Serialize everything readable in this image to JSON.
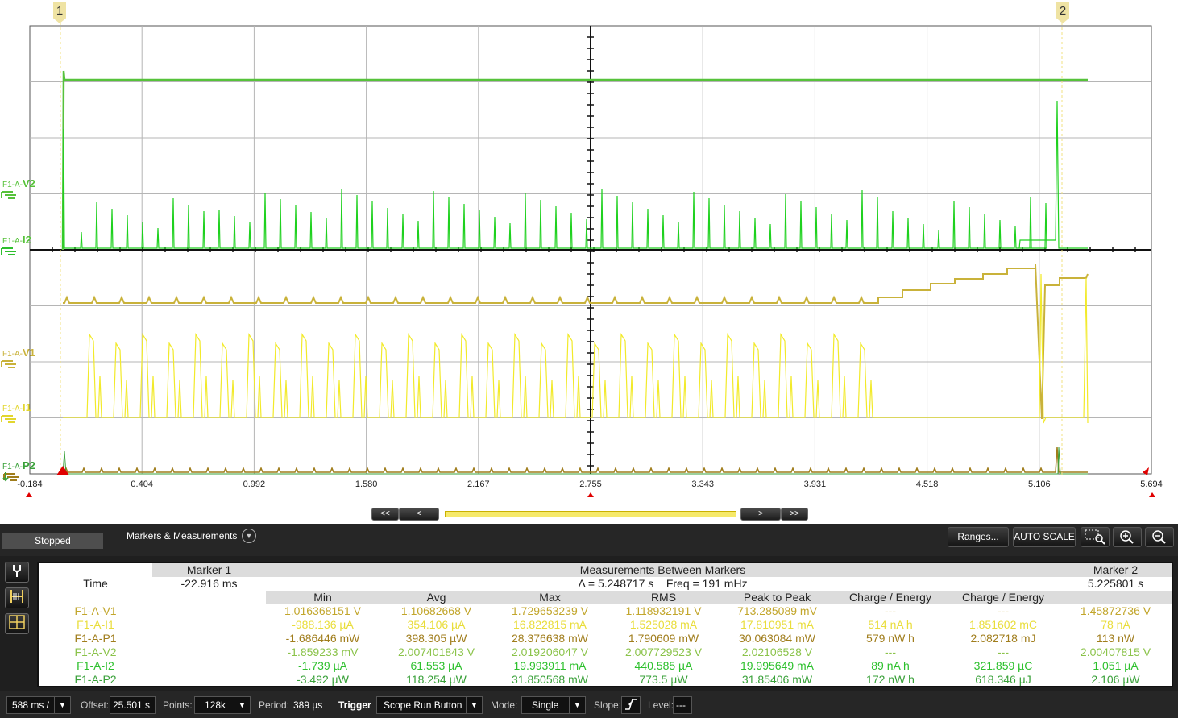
{
  "x_ticks": [
    "-0.184",
    "0.404",
    "0.992",
    "1.580",
    "2.167",
    "2.755",
    "3.343",
    "3.931",
    "4.518",
    "5.106",
    "5.694"
  ],
  "markers": {
    "m1": "1",
    "m2": "2"
  },
  "channels": {
    "V2": {
      "prefix": "F1-A-",
      "name": "V2"
    },
    "I2": {
      "prefix": "F1-A-",
      "name": "I2"
    },
    "V1": {
      "prefix": "F1-A-",
      "name": "V1"
    },
    "I1": {
      "prefix": "F1-A-",
      "name": "I1"
    },
    "P2": {
      "prefix": "F1-A-",
      "name": "P2"
    }
  },
  "nav": {
    "first": "<<",
    "prev": "<",
    "next": ">",
    "last": ">>"
  },
  "status": "Stopped",
  "panel_title": "Markers & Measurements",
  "toolbar": {
    "ranges": "Ranges...",
    "autoscale": "AUTO SCALE"
  },
  "measurements": {
    "marker1_header": "Marker 1",
    "between_header": "Measurements Between Markers",
    "marker2_header": "Marker 2",
    "time_label": "Time",
    "marker1_time": "-22.916 ms",
    "delta": "Δ = 5.248717 s    Freq = 191 mHz",
    "marker2_time": "5.225801 s",
    "columns": [
      "Min",
      "Avg",
      "Max",
      "RMS",
      "Peak to Peak",
      "Charge / Energy",
      "Charge / Energy"
    ],
    "rows": [
      {
        "key": "V1",
        "name": "F1-A-V1",
        "m1": "",
        "cells": [
          "1.016368151 V",
          "1.10682668 V",
          "1.729653239 V",
          "1.118932191 V",
          "713.285089 mV",
          "---",
          "---"
        ],
        "m2": "1.45872736 V"
      },
      {
        "key": "I1",
        "name": "F1-A-I1",
        "m1": "",
        "cells": [
          "-988.136 µA",
          "354.106 µA",
          "16.822815 mA",
          "1.525028 mA",
          "17.810951 mA",
          "514 nA h",
          "1.851602 mC"
        ],
        "m2": "78 nA"
      },
      {
        "key": "P1",
        "name": "F1-A-P1",
        "m1": "",
        "cells": [
          "-1.686446 mW",
          "398.305 µW",
          "28.376638 mW",
          "1.790609 mW",
          "30.063084 mW",
          "579 nW h",
          "2.082718 mJ"
        ],
        "m2": "113 nW"
      },
      {
        "key": "V2",
        "name": "F1-A-V2",
        "m1": "",
        "cells": [
          "-1.859233 mV",
          "2.007401843 V",
          "2.019206047 V",
          "2.007729523 V",
          "2.02106528 V",
          "---",
          "---"
        ],
        "m2": "2.00407815 V"
      },
      {
        "key": "I2",
        "name": "F1-A-I2",
        "m1": "",
        "cells": [
          "-1.739 µA",
          "61.553 µA",
          "19.993911 mA",
          "440.585 µA",
          "19.995649 mA",
          "89 nA h",
          "321.859 µC"
        ],
        "m2": "1.051 µA"
      },
      {
        "key": "P2",
        "name": "F1-A-P2",
        "m1": "",
        "cells": [
          "-3.492 µW",
          "118.254 µW",
          "31.850568 mW",
          "773.5 µW",
          "31.85406 mW",
          "172 nW h",
          "618.346 µJ"
        ],
        "m2": "2.106 µW"
      }
    ]
  },
  "bottom": {
    "timebase": "588 ms /",
    "offset_label": "Offset:",
    "offset_value": "25.501 s",
    "points_label": "Points:",
    "points_value": "128k",
    "period_label": "Period:",
    "period_value": "389 µs",
    "trigger_label": "Trigger",
    "trigger_value": "Scope Run Button",
    "mode_label": "Mode:",
    "mode_value": "Single",
    "slope_label": "Slope:",
    "level_label": "Level:",
    "level_value": "---"
  },
  "colors": {
    "green": "#56c23a",
    "green_bright": "#1ed11e",
    "yellow": "#f2ea2a",
    "gold": "#c9b23a",
    "brown": "#a07d1c"
  }
}
